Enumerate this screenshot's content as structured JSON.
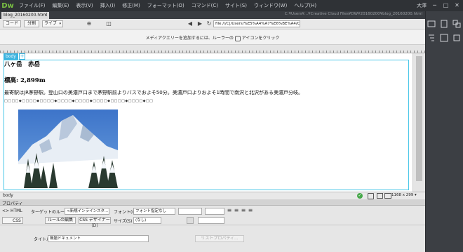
{
  "app": {
    "logo": "Dw",
    "user": "大澤"
  },
  "menu": [
    "ファイル(F)",
    "編集(E)",
    "表示(V)",
    "挿入(I)",
    "修正(M)",
    "フォーマット(O)",
    "コマンド(C)",
    "サイト(S)",
    "ウィンドウ(W)",
    "ヘルプ(H)"
  ],
  "window_controls": {
    "minimize": "─",
    "maximize": "□",
    "close": "✕"
  },
  "document_tab": {
    "name": "blog_20160200.html",
    "close": "×",
    "path": "C:¥Users¥...¥Creative Cloud Files¥DW¥20160200¥blog_20160200.html"
  },
  "doc_toolbar": {
    "code": "コード",
    "split": "分割",
    "live": "ライブ",
    "url": "file:///C|/Users/%E5%A4%A7%E6%BE%A4/Cre"
  },
  "mq_bar": {
    "text_before": "メディアクエリーを追加するには、ルーラーの",
    "text_after": "アイコンをクリック"
  },
  "canvas": {
    "body_tag": "body",
    "plus": "+",
    "heading": "八ヶ岳　赤岳",
    "elevation": "標高: 2,899m",
    "paragraph": "最寄駅はJR茅野駅。登山口の美濃戸口まで茅野駅前よりバスでおよそ50分。美濃戸口よりおよそ1時間で南沢と北沢がある美濃戸分岐。",
    "dots": "□□□□◆□□□□◆□□□□◆□□□□◆□□□□◆□□□□◆□□□□◆□□□□◆□□"
  },
  "statusbar": {
    "tag": "body",
    "size": "1168 x 299 ▾"
  },
  "properties": {
    "title": "プロパティ",
    "html_mode": "<> HTML",
    "css_mode": "CSS",
    "target_rule_label": "ターゲットのルール",
    "target_rule_value": "<新規インラインスタ...",
    "edit_rule": "ルールの編集",
    "css_designer": "CSS デザイナー(D)",
    "font_label": "フォント(O)",
    "font_value": "フォント指定なし",
    "size_label": "サイズ(S)",
    "size_value": "(なし)",
    "page_title_label": "タイトル",
    "page_title_value": "無題ドキュメント",
    "list_props": "リストプロパティ..."
  },
  "colors": {
    "accent": "#3db4e0",
    "menubar": "#2f3236",
    "logo": "#7ac143"
  }
}
